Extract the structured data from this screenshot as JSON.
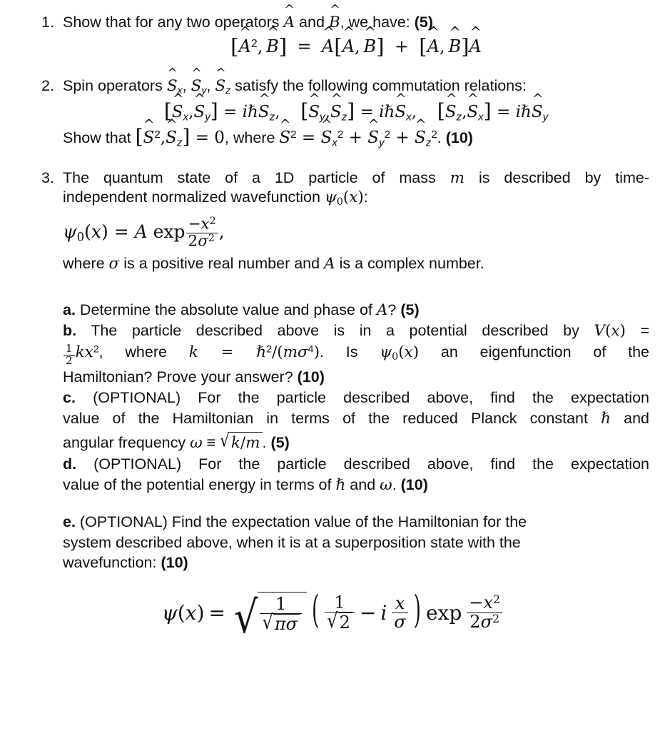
{
  "document": {
    "type": "physics-problem-set",
    "background_color": "#ffffff",
    "text_color": "#111111"
  },
  "problems": [
    {
      "number": "1.",
      "statement_prefix": "Show that for any two operators ",
      "statement_mid": " and ",
      "statement_suffix": ", we have: ",
      "operator_a": "A",
      "operator_b": "B",
      "points": "(5)",
      "equation_plain": "[Â², B̂] = Â[Â, B̂] + [Â, B̂]Â"
    },
    {
      "number": "2.",
      "statement_prefix": "Spin operators ",
      "statement_suffix": " satisfy the following commutation relations:",
      "operators_list": [
        "Ŝx",
        "Ŝy",
        "Ŝz"
      ],
      "commutators_plain": [
        "[Ŝx, Ŝy] = iℏŜz,",
        "[Ŝy, Ŝz] = iℏŜx,",
        "[Ŝz, Ŝx] = iℏŜy"
      ],
      "show_prefix": "Show that ",
      "show_equation_plain": "[Ŝ², Ŝz] = 0",
      "show_mid": ", where ",
      "show_definition_plain": "Ŝ² = Ŝx² + Ŝy² + Ŝz²",
      "show_suffix": ". ",
      "points": "(10)"
    },
    {
      "number": "3.",
      "line1_a": "The quantum state of a 1D particle of mass ",
      "mass_symbol": "m",
      "line1_b": " is described by time-",
      "line2_a": "independent normalized wavefunction ",
      "wavefunction_symbol": "ψ₀(x)",
      "line2_b": ":",
      "equation_plain": "ψ₀(x) = A exp(−x² / 2σ²),",
      "where_a": "where ",
      "sigma_symbol": "σ",
      "where_b": " is a positive real number and ",
      "amplitude_symbol": "A",
      "where_c": " is a complex number."
    }
  ],
  "subparts": [
    {
      "label": "a.",
      "text_a": " Determine the absolute value and phase of ",
      "symbol": "A",
      "text_b": "? ",
      "points": "(5)"
    },
    {
      "label": "b.",
      "text_a": " The particle described above is in a potential described by ",
      "potential_symbol": "V(x)",
      "text_b": " = ",
      "potential_expr_plain": "½kx²",
      "text_c": ", where ",
      "k_expr_plain": "k = ℏ²/(mσ⁴)",
      "text_d": ". Is ",
      "psi_symbol": "ψ₀(x)",
      "text_e": " an eigenfunction of the Hamiltonian? Prove your answer? ",
      "points": "(10)"
    },
    {
      "label": "c.",
      "text_a": " (OPTIONAL) For the particle described above, find the expectation value of the Hamiltonian in terms of the reduced Planck constant ",
      "hbar_symbol": "ℏ",
      "text_b": " and angular frequency ",
      "omega_symbol": "ω",
      "text_c": " ≡ ",
      "omega_expr_plain": "√(k/m)",
      "text_d": ". ",
      "points": "(5)"
    },
    {
      "label": "d.",
      "text_a": " (OPTIONAL) For the particle described above, find the expectation value of the potential energy in terms of ",
      "hbar_symbol": "ℏ",
      "text_b": " and ",
      "omega_symbol": "ω",
      "text_c": ". ",
      "points": "(10)"
    },
    {
      "label": "e.",
      "text_a": " (OPTIONAL) Find the expectation value of the Hamiltonian for the system described above, when it is at a superposition state with the wavefunction: ",
      "points": "(10)"
    }
  ],
  "final_equation": {
    "lhs_plain": "ψ(x)",
    "equals": "=",
    "rhs_plain": "√(1/(√πσ)) (1/√2 − i x/σ) exp(−x²/2σ²)",
    "radicand_num": "1",
    "radicand_den_plain": "√πσ",
    "paren_first_num": "1",
    "paren_first_den_plain": "√2",
    "minus": "−",
    "imaginary_unit": "i",
    "ratio_num": "x",
    "ratio_den": "σ",
    "exp_label": "exp",
    "exp_num_plain": "−x²",
    "exp_den_plain": "2σ²"
  }
}
